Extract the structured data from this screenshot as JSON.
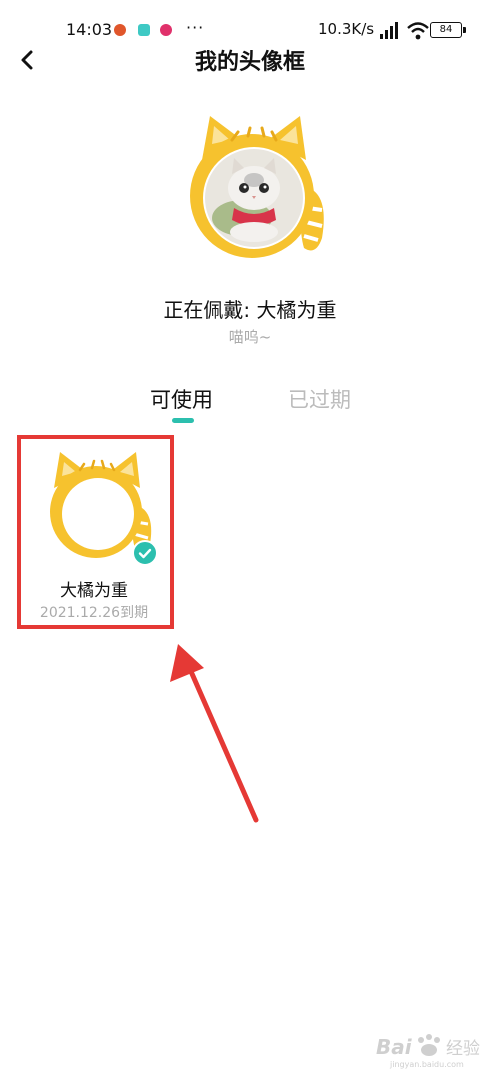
{
  "status_bar": {
    "time": "14:03",
    "dots": "···",
    "network_speed": "10.3K/s",
    "battery": "84"
  },
  "header": {
    "title": "我的头像框",
    "back_icon": "chevron-left-icon"
  },
  "current": {
    "wearing_label": "正在佩戴: 大橘为重",
    "signature": "喵呜~"
  },
  "tabs": [
    {
      "label": "可使用",
      "active": true
    },
    {
      "label": "已过期",
      "active": false
    }
  ],
  "frames": [
    {
      "name": "大橘为重",
      "expiry": "2021.12.26到期",
      "selected": true
    }
  ],
  "watermark": {
    "brand": "Bai",
    "suffix": "经验",
    "url": "jingyan.baidu.com"
  },
  "colors": {
    "accent": "#2cbfae",
    "annotation": "#e53935",
    "frame_orange": "#f6c22e"
  }
}
